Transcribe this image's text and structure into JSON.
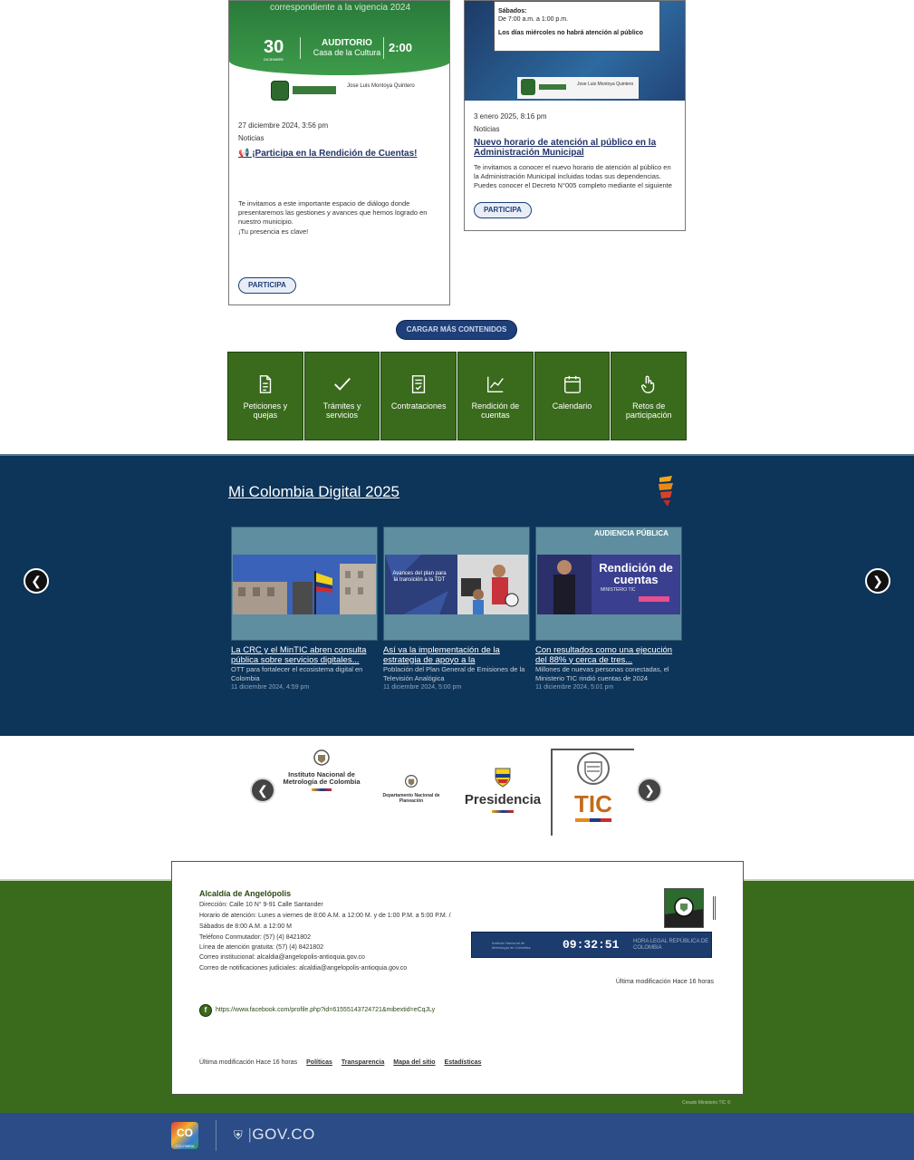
{
  "news": [
    {
      "poster_text": "correspondiente a la vigencia 2024",
      "poster_day": "30",
      "poster_month": "DICIEMBRE",
      "poster_place_title": "AUDITORIO",
      "poster_place": "Casa de la Cultura",
      "poster_time": "2:00",
      "poster_signature": "Jose Luis Montoya Quintero",
      "date": "27 diciembre 2024, 3:56 pm",
      "category": "Noticias",
      "title": "📢 ¡Participa en la Rendición de Cuentas!",
      "body": "Te invitamos a este importante espacio de diálogo donde presentaremos las gestiones y avances que hemos logrado en nuestro municipio.",
      "body2": "¡Tu presencia es clave!",
      "button": "PARTICIPA"
    },
    {
      "poster_saturday": "Sábados:",
      "poster_saturday_hours": "De 7:00 a.m. a 1:00 p.m.",
      "poster_note": "Los días miércoles no habrá atención al público",
      "poster_signature": "Jose Luis Montoya Quintero",
      "date": "3 enero 2025, 8:16 pm",
      "category": "Noticias",
      "title": "Nuevo horario de atención al público en la Administración Municipal",
      "body": "Te invitamos a conocer el nuevo horario de atención al público en la Administración Municipal incluidas todas sus dependencias. Puedes conocer el Decreto N°005 completo mediante el siguiente",
      "button": "PARTICIPA"
    }
  ],
  "load_more": "CARGAR MÁS CONTENIDOS",
  "tiles": [
    {
      "label": "Peticiones y quejas",
      "icon": "document-icon"
    },
    {
      "label": "Trámites y servicios",
      "icon": "checkmark-icon"
    },
    {
      "label": "Contrataciones",
      "icon": "contract-icon"
    },
    {
      "label": "Rendición de cuentas",
      "icon": "chart-icon"
    },
    {
      "label": "Calendario",
      "icon": "calendar-icon"
    },
    {
      "label": "Retos de participación",
      "icon": "hand-icon"
    }
  ],
  "mi_colombia": {
    "title": "Mi Colombia Digital 2025",
    "items": [
      {
        "headline": "La CRC y el MinTIC abren consulta pública sobre servicios digitales...",
        "summary": "OTT para fortalecer el ecosistema digital en Colombia",
        "date": "11 diciembre 2024, 4:59 pm"
      },
      {
        "headline": "Así va la implementación de la estrategia de apoyo a la",
        "summary": "Población del Plan General de Emisiones de la Televisión Analógica",
        "date": "11 diciembre 2024, 5:00 pm",
        "image_text": "Avances del plan para la transición a la TDT"
      },
      {
        "headline": "Con resultados como una ejecución del 88% y cerca de tres...",
        "summary": "Millones de nuevas personas conectadas, el Ministerio TIC rindió cuentas de 2024",
        "date": "11 diciembre 2024, 5:01 pm",
        "image_top": "AUDIENCIA PÚBLICA",
        "image_main": "Rendición de cuentas",
        "image_sub": "MINISTERIO TIC"
      }
    ]
  },
  "partners": {
    "inm": "Instituto Nacional de Metrología de Colombia",
    "dnp": "Departamento Nacional de Planeación",
    "presidencia": "Presidencia",
    "tic": "TIC"
  },
  "footer": {
    "name": "Alcaldía de Angelópolis",
    "lines": [
      "Dirección: Calle 10 N° 9-91 Calle Santander",
      "Horario de atención: Lunes a viernes de 8:00 A.M. a 12:00 M. y de 1:00 P.M. a 5:00 P.M. /",
      "Sábados de 8:00 A.M. a 12:00 M",
      "Teléfono Conmutador: (57) (4) 8421802",
      "Línea de atención gratuita: (57) (4) 8421802",
      "Correo institucional: alcaldia@angelopolis-antioquia.gov.co",
      "Correo de notificaciones judiciales: alcaldia@angelopolis-antioquia.gov.co"
    ],
    "clock": "09:32:51",
    "clock_label": "HORA LEGAL REPÚBLICA DE COLOMBIA",
    "clock_entity": "Instituto Nacional de Metrología de Colombia",
    "modified_right": "Última modificación Hace 16 horas",
    "facebook_url": "https://www.facebook.com/profile.php?id=61555143724721&mibextid=eCqJLy",
    "modified": "Última modificación Hace 16 horas",
    "links": [
      "Políticas",
      "Transparencia",
      "Mapa del sitio",
      "Estadísticas"
    ],
    "credit": "Creado Ministerio TIC ©"
  },
  "govbar": {
    "badge": "CO",
    "badge_sub": "COLOMBIA",
    "text": "GOV.CO"
  },
  "colors": {
    "green": "#3a6b1c",
    "navy": "#0d3459",
    "gov_blue": "#2b4c86"
  }
}
